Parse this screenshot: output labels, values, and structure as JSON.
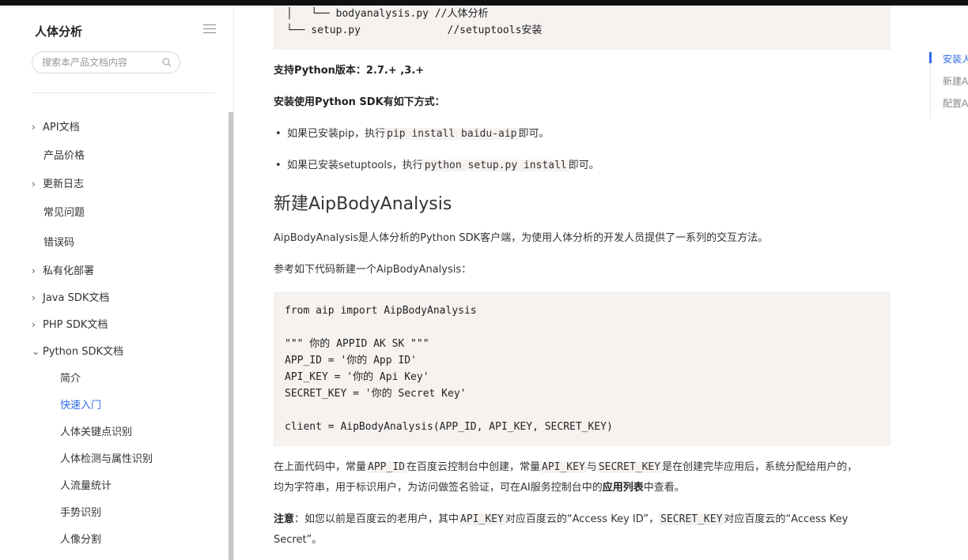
{
  "sidebar": {
    "title": "人体分析",
    "search_placeholder": "搜索本产品文档内容",
    "items": [
      {
        "label": "API文档",
        "chevron": "›"
      },
      {
        "label": "产品价格"
      },
      {
        "label": "更新日志",
        "chevron": "›"
      },
      {
        "label": "常见问题"
      },
      {
        "label": "错误码"
      },
      {
        "label": "私有化部署",
        "chevron": "›"
      },
      {
        "label": "Java SDK文档",
        "chevron": "›"
      },
      {
        "label": "PHP SDK文档",
        "chevron": "›"
      },
      {
        "label": "Python SDK文档",
        "chevron": "⌄"
      }
    ],
    "subitems": [
      {
        "label": "简介"
      },
      {
        "label": "快速入门",
        "active": true
      },
      {
        "label": "人体关键点识别"
      },
      {
        "label": "人体检测与属性识别"
      },
      {
        "label": "人流量统计"
      },
      {
        "label": "手势识别"
      },
      {
        "label": "人像分割"
      }
    ]
  },
  "main": {
    "code_top": [
      "│   └── bodyanalysis.py //人体分析",
      "└── setup.py              //setuptools安装"
    ],
    "python_version": "支持Python版本：2.7.+ ,3.+",
    "install_title": "安装使用Python SDK有如下方式：",
    "bullet1_pre": "如果已安装pip，执行",
    "bullet1_code": "pip install baidu-aip",
    "bullet1_post": "即可。",
    "bullet2_pre": "如果已安装setuptools，执行",
    "bullet2_code": "python setup.py install",
    "bullet2_post": "即可。",
    "heading": "新建AipBodyAnalysis",
    "intro": "AipBodyAnalysis是人体分析的Python SDK客户端，为使用人体分析的开发人员提供了一系列的交互方法。",
    "ref": "参考如下代码新建一个AipBodyAnalysis：",
    "code_main": [
      "from aip import AipBodyAnalysis",
      "",
      "\"\"\" 你的 APPID AK SK \"\"\"",
      "APP_ID = '你的 App ID'",
      "API_KEY = '你的 Api Key'",
      "SECRET_KEY = '你的 Secret Key'",
      "",
      "client = AipBodyAnalysis(APP_ID, API_KEY, SECRET_KEY)"
    ],
    "desc_a": "在上面代码中，常量",
    "desc_c1": "APP_ID",
    "desc_b": "在百度云控制台中创建，常量",
    "desc_c2": "API_KEY",
    "desc_c": "与",
    "desc_c3": "SECRET_KEY",
    "desc_d": "是在创建完毕应用后，系统分配给用户的，",
    "desc_e": "均为字符串，用于标识用户，为访问做签名验证，可在AI服务控制台中的",
    "desc_bold": "应用列表",
    "desc_f": "中查看。",
    "note_label": "注意",
    "note_a": "：如您以前是百度云的老用户，其中",
    "note_c1": "API_KEY",
    "note_b": "对应百度云的“Access Key ID”，",
    "note_c2": "SECRET_KEY",
    "note_c": "对应百度云的“Access Key",
    "note_d": "Secret”。"
  },
  "toc": {
    "items": [
      {
        "label": "安装人",
        "active": true
      },
      {
        "label": "新建A"
      },
      {
        "label": "配置A"
      }
    ]
  },
  "colors": {
    "accent": "#2e6be6",
    "code_bg": "#f5f2f0"
  }
}
